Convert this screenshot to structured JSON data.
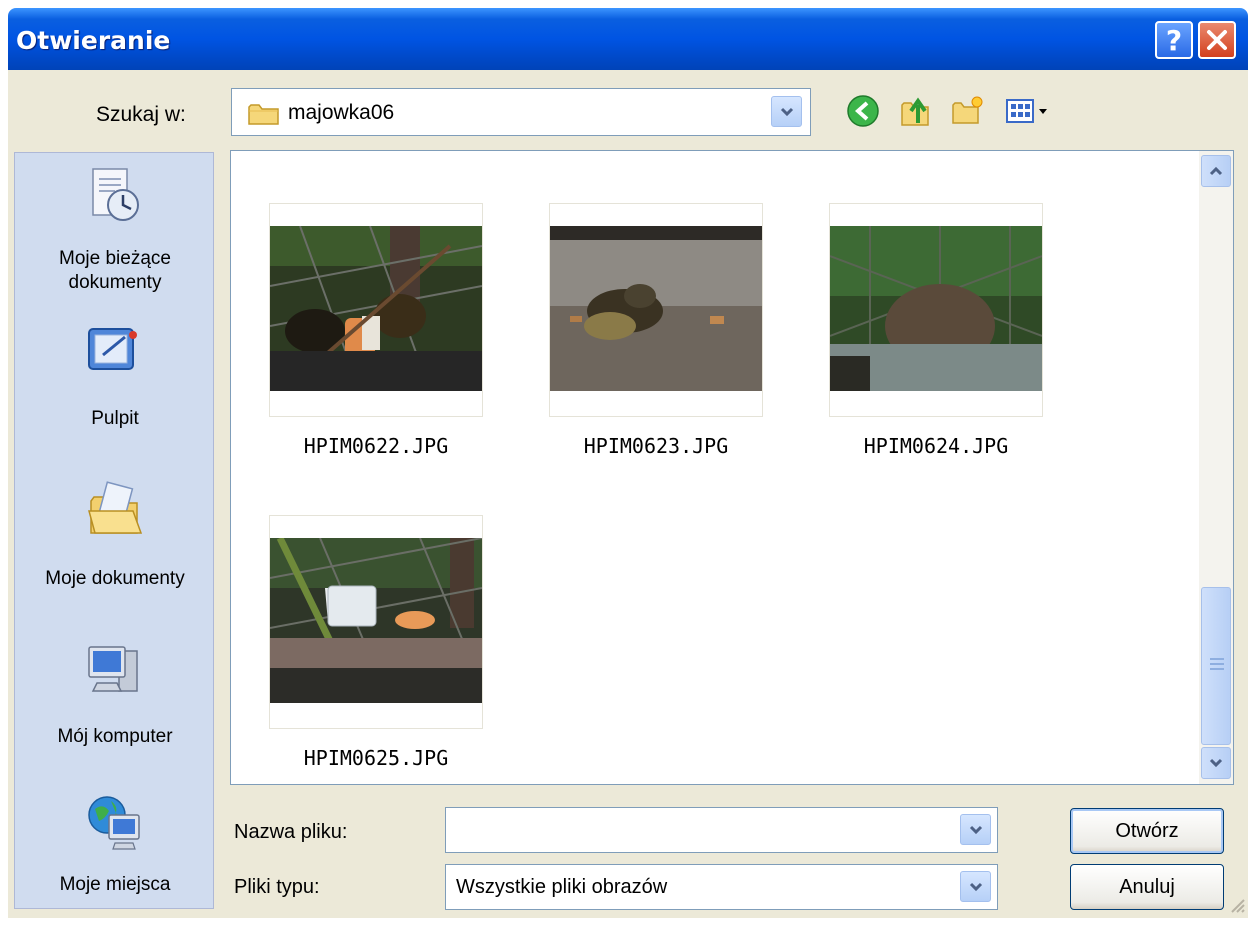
{
  "window": {
    "title": "Otwieranie",
    "help_glyph": "?",
    "close_glyph": "✕"
  },
  "look_in": {
    "label": "Szukaj w:",
    "value": "majowka06",
    "icon": "folder-icon"
  },
  "toolbar": {
    "icons": [
      "back-icon",
      "up-folder-icon",
      "new-folder-icon",
      "view-menu-icon"
    ]
  },
  "places": [
    {
      "label": "Moje bieżące dokumenty",
      "line1": "Moje bieżące",
      "line2": "dokumenty",
      "icon": "recent-documents-icon"
    },
    {
      "label": "Pulpit",
      "line1": "Pulpit",
      "line2": "",
      "icon": "desktop-icon"
    },
    {
      "label": "Moje dokumenty",
      "line1": "Moje dokumenty",
      "line2": "",
      "icon": "my-documents-icon"
    },
    {
      "label": "Mój komputer",
      "line1": "Mój komputer",
      "line2": "",
      "icon": "my-computer-icon"
    },
    {
      "label": "Moje miejsca",
      "line1": "Moje miejsca",
      "line2": "",
      "icon": "network-places-icon"
    }
  ],
  "files": [
    {
      "name": "HPIM0622.JPG"
    },
    {
      "name": "HPIM0623.JPG"
    },
    {
      "name": "HPIM0624.JPG"
    },
    {
      "name": "HPIM0625.JPG"
    }
  ],
  "filename": {
    "label": "Nazwa pliku:",
    "value": ""
  },
  "filetype": {
    "label": "Pliki typu:",
    "value": "Wszystkie pliki obrazów"
  },
  "buttons": {
    "open": "Otwórz",
    "cancel": "Anuluj"
  },
  "colors": {
    "title_bar": "#0054e3",
    "dialog_bg": "#ece9d8",
    "places_bg": "#d0dcef"
  }
}
